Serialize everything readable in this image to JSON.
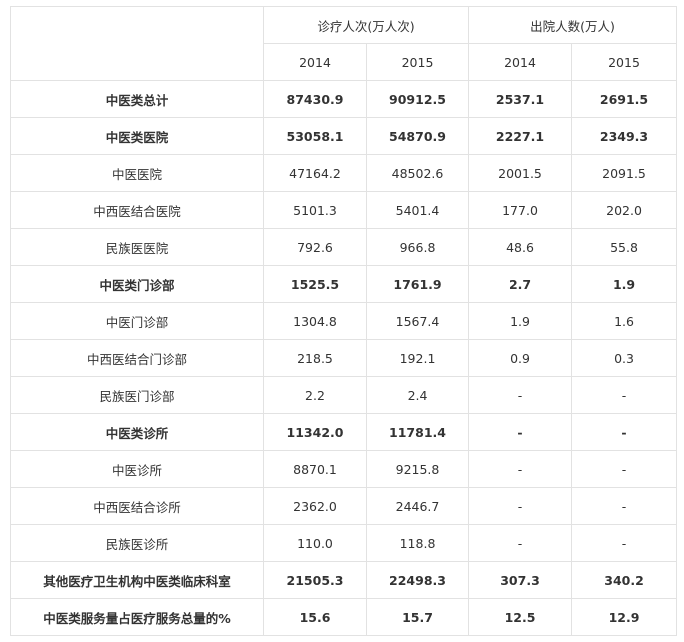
{
  "header": {
    "group1": "诊疗人次(万人次)",
    "group2": "出院人数(万人)",
    "years": [
      "2014",
      "2015",
      "2014",
      "2015"
    ]
  },
  "rows": [
    {
      "label": "中医类总计",
      "bold": true,
      "values": [
        "87430.9",
        "90912.5",
        "2537.1",
        "2691.5"
      ]
    },
    {
      "label": "中医类医院",
      "bold": true,
      "values": [
        "53058.1",
        "54870.9",
        "2227.1",
        "2349.3"
      ]
    },
    {
      "label": "中医医院",
      "bold": false,
      "values": [
        "47164.2",
        "48502.6",
        "2001.5",
        "2091.5"
      ]
    },
    {
      "label": "中西医结合医院",
      "bold": false,
      "values": [
        "5101.3",
        "5401.4",
        "177.0",
        "202.0"
      ]
    },
    {
      "label": "民族医医院",
      "bold": false,
      "values": [
        "792.6",
        "966.8",
        "48.6",
        "55.8"
      ]
    },
    {
      "label": "中医类门诊部",
      "bold": true,
      "values": [
        "1525.5",
        "1761.9",
        "2.7",
        "1.9"
      ]
    },
    {
      "label": "中医门诊部",
      "bold": false,
      "values": [
        "1304.8",
        "1567.4",
        "1.9",
        "1.6"
      ]
    },
    {
      "label": "中西医结合门诊部",
      "bold": false,
      "values": [
        "218.5",
        "192.1",
        "0.9",
        "0.3"
      ]
    },
    {
      "label": "民族医门诊部",
      "bold": false,
      "values": [
        "2.2",
        "2.4",
        "-",
        "-"
      ]
    },
    {
      "label": "中医类诊所",
      "bold": true,
      "values": [
        "11342.0",
        "11781.4",
        "-",
        "-"
      ]
    },
    {
      "label": "中医诊所",
      "bold": false,
      "values": [
        "8870.1",
        "9215.8",
        "-",
        "-"
      ]
    },
    {
      "label": "中西医结合诊所",
      "bold": false,
      "values": [
        "2362.0",
        "2446.7",
        "-",
        "-"
      ]
    },
    {
      "label": "民族医诊所",
      "bold": false,
      "values": [
        "110.0",
        "118.8",
        "-",
        "-"
      ]
    },
    {
      "label": "其他医疗卫生机构中医类临床科室",
      "bold": true,
      "values": [
        "21505.3",
        "22498.3",
        "307.3",
        "340.2"
      ]
    },
    {
      "label": "中医类服务量占医疗服务总量的%",
      "bold": true,
      "values": [
        "15.6",
        "15.7",
        "12.5",
        "12.9"
      ]
    }
  ]
}
